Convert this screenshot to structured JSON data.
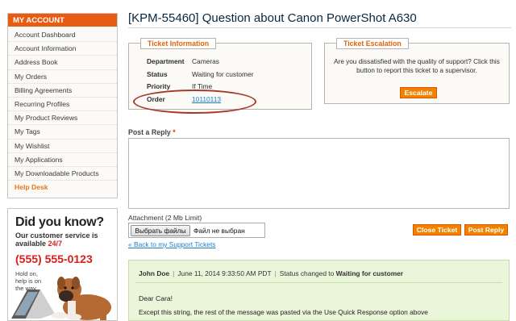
{
  "sidebar": {
    "title": "MY ACCOUNT",
    "items": [
      {
        "label": "Account Dashboard"
      },
      {
        "label": "Account Information"
      },
      {
        "label": "Address Book"
      },
      {
        "label": "My Orders"
      },
      {
        "label": "Billing Agreements"
      },
      {
        "label": "Recurring Profiles"
      },
      {
        "label": "My Product Reviews"
      },
      {
        "label": "My Tags"
      },
      {
        "label": "My Wishlist"
      },
      {
        "label": "My Applications"
      },
      {
        "label": "My Downloadable Products"
      },
      {
        "label": "Help Desk"
      }
    ]
  },
  "promo": {
    "title": "Did you know?",
    "line1": "Our customer service is",
    "line2_prefix": "available ",
    "line2_hl": "24/7",
    "phone": "(555) 555-0123",
    "hold": "Hold on, help is on the way."
  },
  "page": {
    "title": "[KPM-55460] Question about Canon PowerShot A630"
  },
  "ticket_info": {
    "legend": "Ticket Information",
    "rows": [
      {
        "key": "Department",
        "value": "Cameras"
      },
      {
        "key": "Status",
        "value": "Waiting for customer"
      },
      {
        "key": "Priority",
        "value": "If Time"
      },
      {
        "key": "Order",
        "value": "10110113"
      }
    ]
  },
  "escalation": {
    "legend": "Ticket Escalation",
    "text": "Are you dissatisfied with the quality of support? Click this button to report this ticket to a supervisor.",
    "button": "Escalate"
  },
  "reply": {
    "label": "Post a Reply",
    "required_mark": "*",
    "attachment_label": "Attachment (2 Mb Limit)",
    "file_button": "Выбрать файлы",
    "file_status": "Файл не выбран",
    "close_button": "Close Ticket",
    "post_button": "Post Reply",
    "back_link": "« Back to my Support Tickets"
  },
  "message": {
    "author": "John Doe",
    "date": "June 11, 2014 9:33:50 AM PDT",
    "status_prefix": "Status changed to",
    "status": "Waiting for customer",
    "greeting": "Dear Cara!",
    "body": "Except this string, the rest of the message was pasted via the Use Quick Response option above"
  },
  "colors": {
    "accent": "#f18200",
    "header_orange": "#e75b12",
    "title_navy": "#0a263c",
    "link": "#1e7ec8",
    "message_bg": "#eaf6da",
    "phone_red": "#d91c1c"
  }
}
